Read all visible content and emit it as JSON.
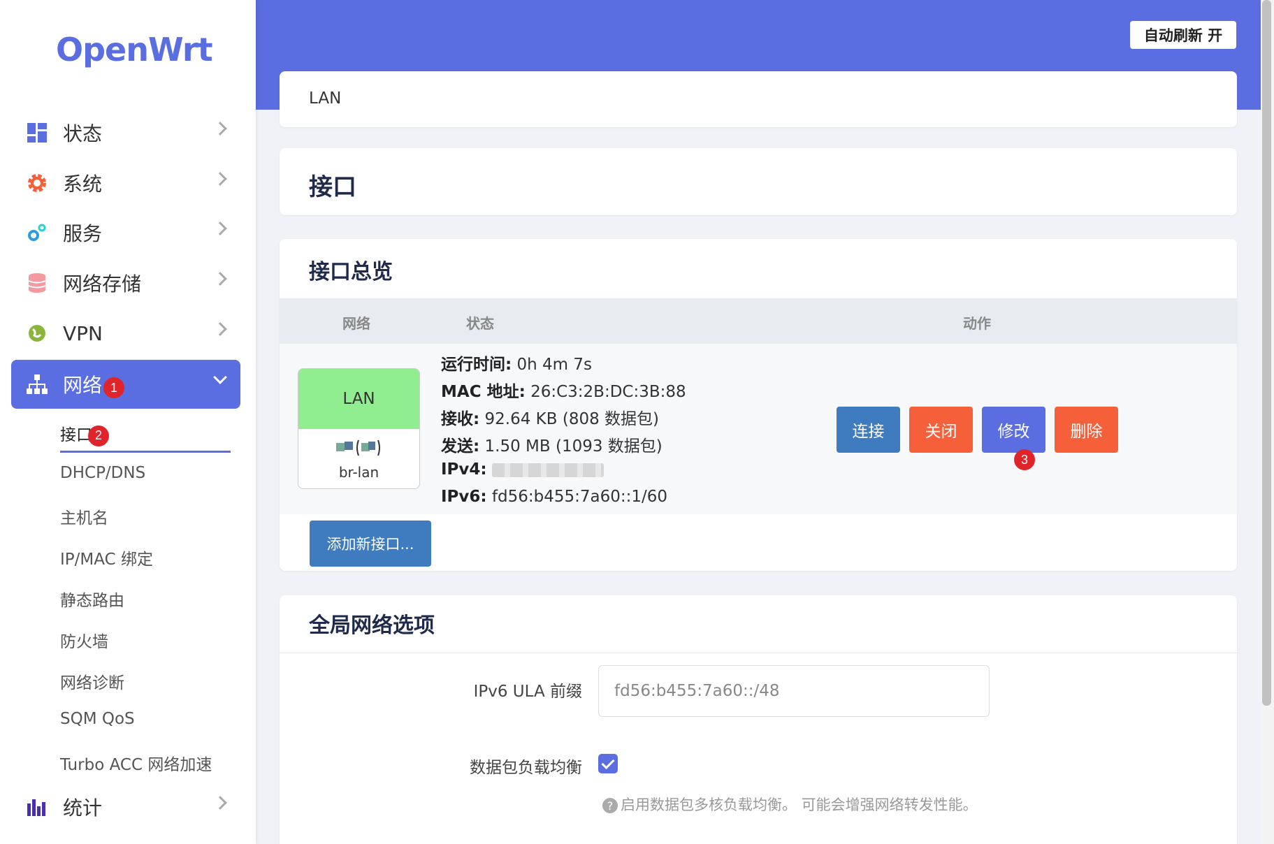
{
  "app": {
    "logo": "OpenWrt",
    "auto_refresh": "自动刷新 开"
  },
  "sidebar": {
    "items": [
      {
        "label": "状态",
        "icon": "dashboard-icon"
      },
      {
        "label": "系统",
        "icon": "gear-icon"
      },
      {
        "label": "服务",
        "icon": "gears-icon"
      },
      {
        "label": "网络存储",
        "icon": "database-icon"
      },
      {
        "label": "VPN",
        "icon": "globe-icon"
      },
      {
        "label": "网络",
        "icon": "network-icon",
        "badge": "1"
      },
      {
        "label": "统计",
        "icon": "bar-chart-icon"
      }
    ],
    "submenu": [
      {
        "label": "接口",
        "badge": "2"
      },
      {
        "label": "DHCP/DNS"
      },
      {
        "label": "主机名"
      },
      {
        "label": "IP/MAC 绑定"
      },
      {
        "label": "静态路由"
      },
      {
        "label": "防火墙"
      },
      {
        "label": "网络诊断"
      },
      {
        "label": "SQM QoS"
      },
      {
        "label": "Turbo ACC 网络加速"
      }
    ]
  },
  "breadcrumb": "LAN",
  "page_title": "接口",
  "overview": {
    "title": "接口总览",
    "columns": [
      "网络",
      "状态",
      "动作"
    ],
    "row": {
      "name": "LAN",
      "name_color": "#90ee90",
      "device": "br-lan",
      "status": [
        {
          "label": "运行时间:",
          "value": " 0h 4m 7s"
        },
        {
          "label": "MAC 地址:",
          "value": " 26:C3:2B:DC:3B:88"
        },
        {
          "label": "接收:",
          "value": " 92.64 KB (808 数据包)"
        },
        {
          "label": "发送:",
          "value": " 1.50 MB (1093 数据包)"
        },
        {
          "label": "IPv4:",
          "value": ""
        },
        {
          "label": "IPv6:",
          "value": " fd56:b455:7a60::1/60"
        }
      ],
      "actions": [
        "连接",
        "关闭",
        "修改",
        "删除"
      ],
      "action_badge": "3"
    },
    "add_button": "添加新接口..."
  },
  "global": {
    "title": "全局网络选项",
    "ula_label": "IPv6 ULA 前缀",
    "ula_value": "fd56:b455:7a60::/48",
    "balance_label": "数据包负载均衡",
    "balance_checked": true,
    "balance_help": "启用数据包多核负载均衡。 可能会增强网络转发性能。"
  },
  "colors": {
    "accent": "#5b6ee1",
    "blue_button": "#3f7bbf",
    "red_button": "#f5603a",
    "badge": "#e0242a"
  }
}
